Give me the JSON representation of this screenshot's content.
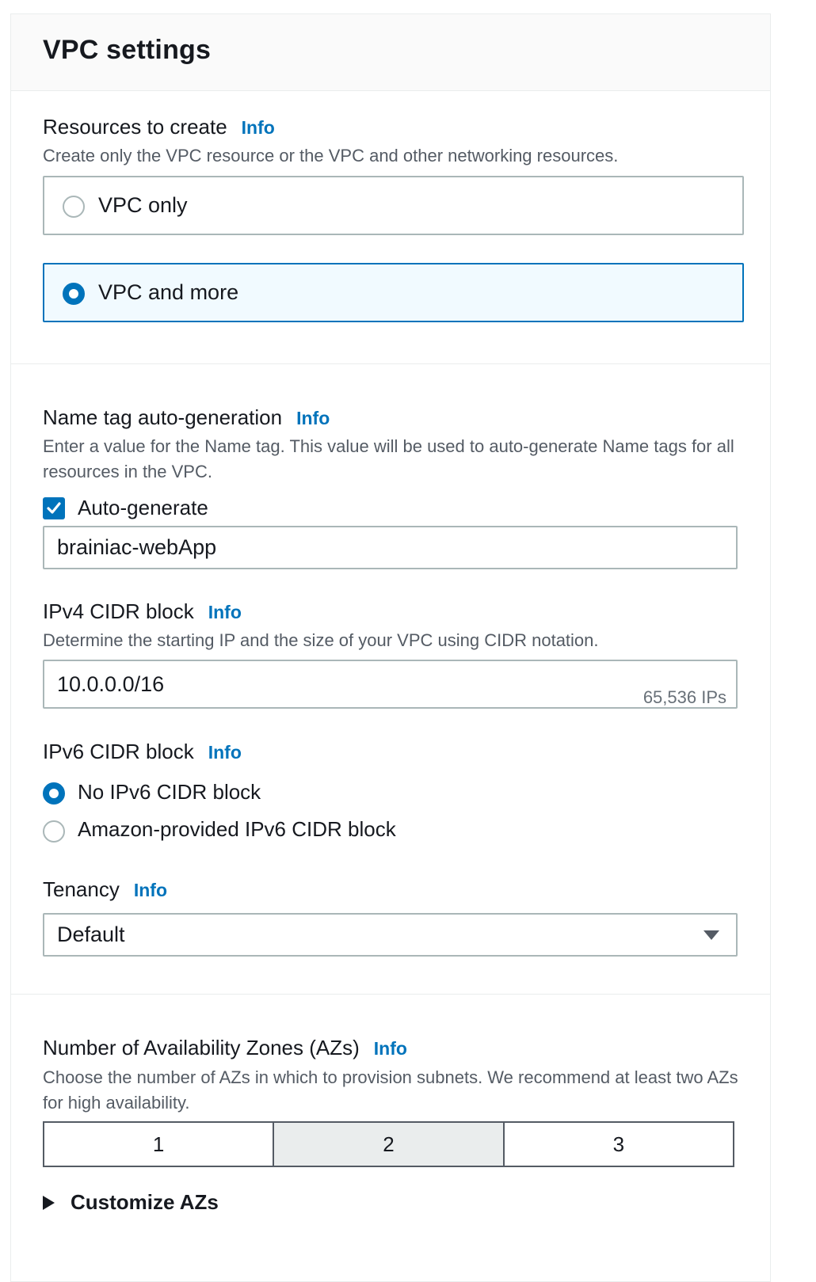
{
  "panel": {
    "title": "VPC settings"
  },
  "resources": {
    "label": "Resources to create",
    "info": "Info",
    "description": "Create only the VPC resource or the VPC and other networking resources.",
    "options": [
      {
        "label": "VPC only",
        "selected": false
      },
      {
        "label": "VPC and more",
        "selected": true
      }
    ]
  },
  "name_tag": {
    "label": "Name tag auto-generation",
    "info": "Info",
    "description": "Enter a value for the Name tag. This value will be used to auto-generate Name tags for all resources in the VPC.",
    "checkbox_label": "Auto-generate",
    "checked": true,
    "value": "brainiac-webApp"
  },
  "ipv4": {
    "label": "IPv4 CIDR block",
    "info": "Info",
    "description": "Determine the starting IP and the size of your VPC using CIDR notation.",
    "value": "10.0.0.0/16",
    "hint": "65,536 IPs"
  },
  "ipv6": {
    "label": "IPv6 CIDR block",
    "info": "Info",
    "options": [
      {
        "label": "No IPv6 CIDR block",
        "selected": true
      },
      {
        "label": "Amazon-provided IPv6 CIDR block",
        "selected": false
      }
    ]
  },
  "tenancy": {
    "label": "Tenancy",
    "info": "Info",
    "selected": "Default"
  },
  "azs": {
    "label": "Number of Availability Zones (AZs)",
    "info": "Info",
    "description": "Choose the number of AZs in which to provision subnets. We recommend at least two AZs for high availability.",
    "options": [
      "1",
      "2",
      "3"
    ],
    "selected": "2",
    "customize_label": "Customize AZs"
  },
  "colors": {
    "accent": "#0073bb",
    "border": "#aab7b8",
    "selected_tile_bg": "#f1faff"
  },
  "icons": [
    "radio-icon",
    "checkbox-check-icon",
    "caret-down-icon",
    "caret-right-icon"
  ]
}
